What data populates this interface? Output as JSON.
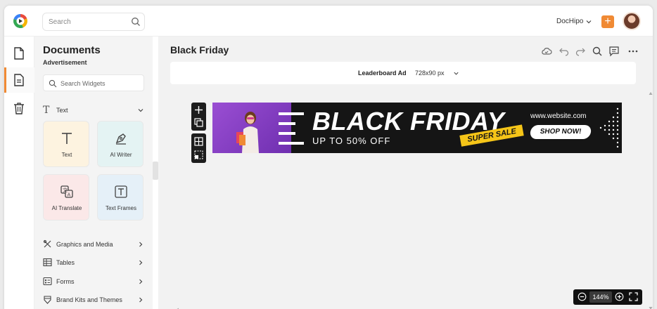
{
  "topbar": {
    "search_placeholder": "Search",
    "brand_label": "DocHipo",
    "add_button_label": "+"
  },
  "rail": {
    "items": [
      "documents-icon",
      "document-active-icon",
      "trash-icon"
    ]
  },
  "panel": {
    "title": "Documents",
    "subtitle": "Advertisement",
    "widget_search_placeholder": "Search Widgets",
    "text_section_label": "Text",
    "cards": [
      {
        "label": "Text",
        "icon": "text-icon"
      },
      {
        "label": "AI Writer",
        "icon": "pen-nib-icon"
      },
      {
        "label": "AI Translate",
        "icon": "translate-icon"
      },
      {
        "label": "Text Frames",
        "icon": "text-frame-icon"
      }
    ],
    "categories": [
      {
        "label": "Graphics and Media",
        "icon": "graphics-icon"
      },
      {
        "label": "Tables",
        "icon": "table-icon"
      },
      {
        "label": "Forms",
        "icon": "form-icon"
      },
      {
        "label": "Brand Kits and Themes",
        "icon": "brand-kit-icon"
      }
    ]
  },
  "main": {
    "doc_title": "Black Friday",
    "size_label": "Leaderboard Ad",
    "size_dims": "728x90 px",
    "zoom_level": "144%"
  },
  "banner": {
    "headline": "BLACK FRIDAY",
    "subline": "UP TO 50% OFF",
    "badge": "SUPER SALE",
    "website": "www.website.com",
    "cta": "SHOP NOW!",
    "colors": {
      "accent": "#f5c518",
      "photo_bg": "#8a3fd0",
      "bg": "#151515"
    }
  },
  "colors": {
    "brand_orange": "#f08a34"
  }
}
